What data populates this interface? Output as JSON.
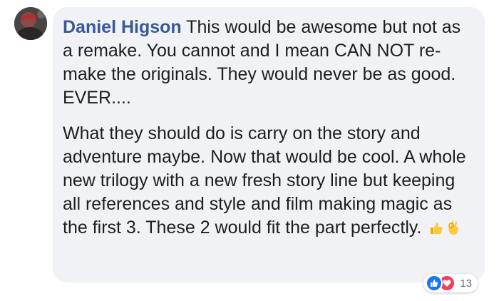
{
  "comment": {
    "author": "Daniel Higson",
    "paragraph1": " This would be awesome but not as a remake. You cannot and I mean CAN NOT re-make the originals. They would never be as good. EVER....",
    "paragraph2": "What they should do is carry on the story and adventure maybe. Now that would be cool. A whole new trilogy with a new fresh story line but keeping all references and style and film making magic as the first 3. These 2 would fit the part perfectly.",
    "emojis": [
      "thumbs-up-icon",
      "ok-hand-icon"
    ]
  },
  "reactions": {
    "types": [
      "like-icon",
      "love-icon"
    ],
    "count": "13",
    "colors": {
      "like": "#1877f2",
      "love": "#f33e58"
    }
  },
  "colors": {
    "author": "#385898",
    "text": "#1c1e21",
    "bubble": "#f0f2f5"
  }
}
